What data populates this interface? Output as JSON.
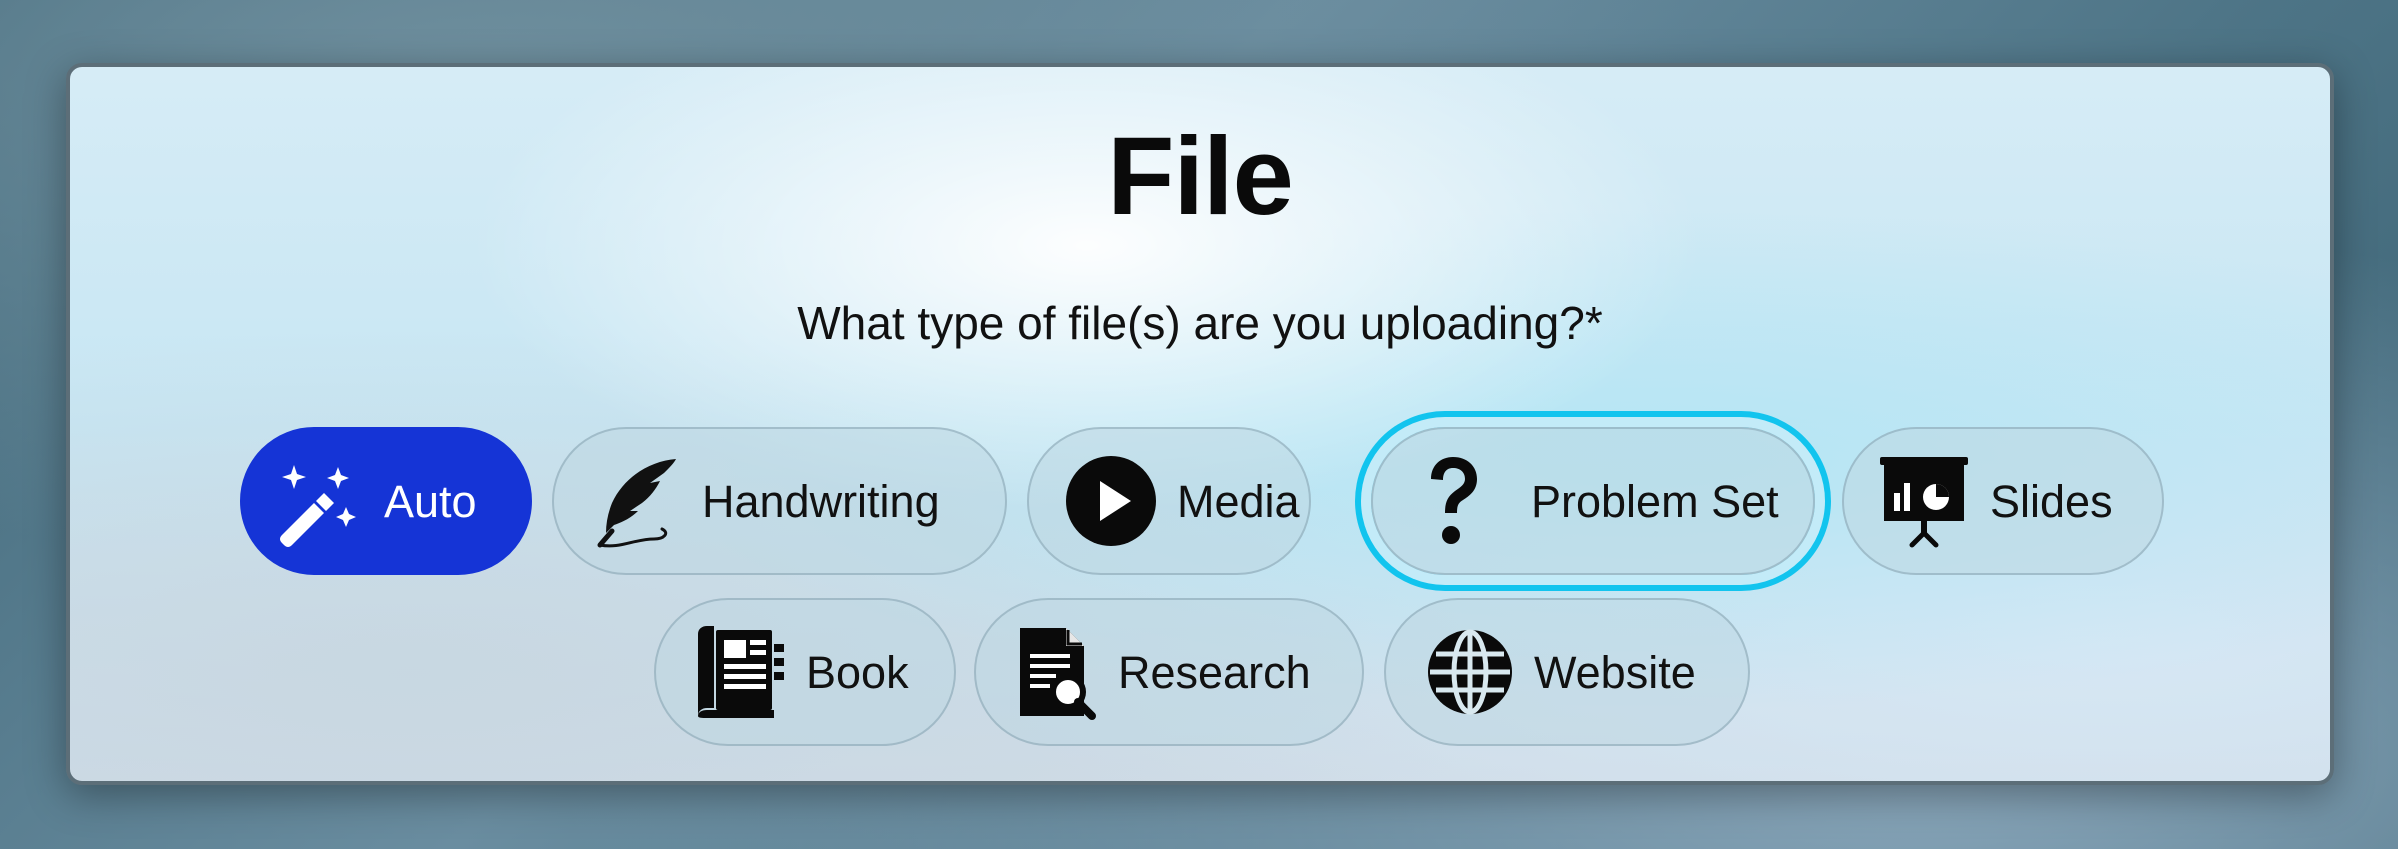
{
  "dialog": {
    "title": "File",
    "question": "What type of file(s) are you uploading?*"
  },
  "file_types": [
    {
      "label": "Auto",
      "icon": "magic-wand-icon",
      "selected": true
    },
    {
      "label": "Handwriting",
      "icon": "quill-feather-icon"
    },
    {
      "label": "Media",
      "icon": "play-circle-icon"
    },
    {
      "label": "Problem Set",
      "icon": "question-mark-icon",
      "focused": true
    },
    {
      "label": "Slides",
      "icon": "presentation-chart-icon"
    },
    {
      "label": "Book",
      "icon": "book-newspaper-icon"
    },
    {
      "label": "Research",
      "icon": "document-search-icon"
    },
    {
      "label": "Website",
      "icon": "globe-icon"
    }
  ],
  "colors": {
    "selected": "#1534d6",
    "focus_ring": "#12c4ee"
  }
}
